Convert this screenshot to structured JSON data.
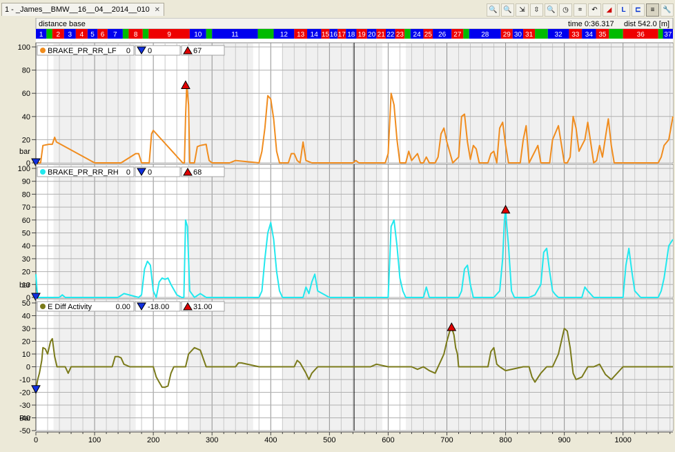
{
  "window": {
    "tab_title": "1 - _James__BMW__16__04__2014__010"
  },
  "toolbar": {
    "icons": [
      "zoom-2d-icon",
      "zoom-in-icon",
      "zoom-x-icon",
      "zoom-y-icon",
      "zoom-out-icon",
      "clock-icon",
      "overlay-icon",
      "undo-icon",
      "triangle-marker-icon",
      "axis-l-icon",
      "axis-steps-icon",
      "grid-lines-icon",
      "wrench-icon"
    ]
  },
  "header": {
    "base_label": "distance base",
    "time_label": "time 0:36.317",
    "dist_label": "dist 542.0 [m]"
  },
  "colors": {
    "segment_blue": "#0000ee",
    "segment_red": "#ee0000",
    "segment_green": "#00bb00",
    "plot_bg": "#ffffff",
    "shade_bg": "#f0f0f0"
  },
  "segments": [
    {
      "label": "1",
      "color": "blue",
      "start": 0,
      "end": 18
    },
    {
      "label": "",
      "color": "green",
      "start": 18,
      "end": 28
    },
    {
      "label": "2",
      "color": "red",
      "start": 28,
      "end": 48
    },
    {
      "label": "3",
      "color": "blue",
      "start": 48,
      "end": 68
    },
    {
      "label": "4",
      "color": "red",
      "start": 68,
      "end": 88
    },
    {
      "label": "5",
      "color": "blue",
      "start": 88,
      "end": 105
    },
    {
      "label": "6",
      "color": "red",
      "start": 105,
      "end": 122
    },
    {
      "label": "7",
      "color": "blue",
      "start": 122,
      "end": 148
    },
    {
      "label": "",
      "color": "green",
      "start": 148,
      "end": 158
    },
    {
      "label": "8",
      "color": "red",
      "start": 158,
      "end": 182
    },
    {
      "label": "",
      "color": "green",
      "start": 182,
      "end": 192
    },
    {
      "label": "9",
      "color": "red",
      "start": 192,
      "end": 262
    },
    {
      "label": "10",
      "color": "blue",
      "start": 262,
      "end": 290
    },
    {
      "label": "",
      "color": "green",
      "start": 290,
      "end": 300
    },
    {
      "label": "11",
      "color": "blue",
      "start": 300,
      "end": 378
    },
    {
      "label": "",
      "color": "green",
      "start": 378,
      "end": 405
    },
    {
      "label": "12",
      "color": "blue",
      "start": 405,
      "end": 440
    },
    {
      "label": "13",
      "color": "red",
      "start": 440,
      "end": 462
    },
    {
      "label": "14",
      "color": "blue",
      "start": 462,
      "end": 486
    },
    {
      "label": "15",
      "color": "red",
      "start": 486,
      "end": 500
    },
    {
      "label": "16",
      "color": "blue",
      "start": 500,
      "end": 514
    },
    {
      "label": "17",
      "color": "red",
      "start": 514,
      "end": 528
    },
    {
      "label": "18",
      "color": "blue",
      "start": 528,
      "end": 546
    },
    {
      "label": "19",
      "color": "red",
      "start": 546,
      "end": 564
    },
    {
      "label": "20",
      "color": "blue",
      "start": 564,
      "end": 580
    },
    {
      "label": "21",
      "color": "red",
      "start": 580,
      "end": 596
    },
    {
      "label": "22",
      "color": "blue",
      "start": 596,
      "end": 612
    },
    {
      "label": "23",
      "color": "red",
      "start": 612,
      "end": 628
    },
    {
      "label": "",
      "color": "green",
      "start": 628,
      "end": 638
    },
    {
      "label": "24",
      "color": "blue",
      "start": 638,
      "end": 660
    },
    {
      "label": "25",
      "color": "red",
      "start": 660,
      "end": 676
    },
    {
      "label": "26",
      "color": "blue",
      "start": 676,
      "end": 708
    },
    {
      "label": "27",
      "color": "red",
      "start": 708,
      "end": 728
    },
    {
      "label": "",
      "color": "green",
      "start": 728,
      "end": 738
    },
    {
      "label": "28",
      "color": "blue",
      "start": 738,
      "end": 792
    },
    {
      "label": "29",
      "color": "red",
      "start": 792,
      "end": 812
    },
    {
      "label": "30",
      "color": "blue",
      "start": 812,
      "end": 830
    },
    {
      "label": "31",
      "color": "red",
      "start": 830,
      "end": 850
    },
    {
      "label": "",
      "color": "green",
      "start": 850,
      "end": 872
    },
    {
      "label": "32",
      "color": "blue",
      "start": 872,
      "end": 908
    },
    {
      "label": "33",
      "color": "red",
      "start": 908,
      "end": 930
    },
    {
      "label": "34",
      "color": "blue",
      "start": 930,
      "end": 954
    },
    {
      "label": "35",
      "color": "red",
      "start": 954,
      "end": 976
    },
    {
      "label": "",
      "color": "green",
      "start": 976,
      "end": 1000
    },
    {
      "label": "36",
      "color": "red",
      "start": 1000,
      "end": 1060
    },
    {
      "label": "",
      "color": "green",
      "start": 1060,
      "end": 1068
    },
    {
      "label": "37",
      "color": "blue",
      "start": 1068,
      "end": 1085
    }
  ],
  "chart_data": {
    "type": "line",
    "x_axis": {
      "label": "",
      "range": [
        0,
        1085
      ],
      "ticks": [
        0,
        100,
        200,
        300,
        400,
        500,
        600,
        700,
        800,
        900,
        1000
      ]
    },
    "cursor_x": 542.0,
    "panels": [
      {
        "name": "BRAKE_PR_RR_LF",
        "value_text": "0",
        "min_text": "0",
        "max_text": "67",
        "unit": "bar",
        "color": "#f08c1e",
        "ylim": [
          0,
          100
        ],
        "yticks": [
          0,
          20,
          40,
          60,
          80,
          100
        ],
        "min_marker": {
          "x": 0,
          "y": 0
        },
        "max_marker": {
          "x": 255,
          "y": 67
        },
        "x": [
          0,
          8,
          12,
          22,
          28,
          32,
          35,
          100,
          130,
          135,
          145,
          170,
          175,
          180,
          185,
          190,
          193,
          197,
          200,
          250,
          253,
          255,
          257,
          260,
          262,
          270,
          275,
          280,
          290,
          292,
          295,
          300,
          330,
          340,
          380,
          385,
          390,
          395,
          400,
          405,
          410,
          415,
          430,
          435,
          440,
          445,
          450,
          455,
          460,
          470,
          475,
          480,
          485,
          500,
          540,
          545,
          550,
          595,
          600,
          605,
          610,
          615,
          620,
          630,
          635,
          640,
          650,
          655,
          660,
          665,
          670,
          675,
          680,
          685,
          690,
          695,
          700,
          710,
          720,
          725,
          730,
          735,
          740,
          745,
          750,
          755,
          760,
          770,
          775,
          780,
          785,
          790,
          795,
          800,
          805,
          810,
          815,
          820,
          825,
          830,
          835,
          840,
          850,
          855,
          860,
          870,
          875,
          880,
          890,
          900,
          905,
          910,
          915,
          920,
          925,
          930,
          935,
          940,
          950,
          955,
          960,
          965,
          970,
          975,
          980,
          985,
          990,
          1000,
          1010,
          1020,
          1030,
          1040,
          1050,
          1060,
          1065,
          1070,
          1078,
          1085
        ],
        "y": [
          0,
          0,
          15,
          16,
          16,
          22,
          18,
          0,
          0,
          0,
          0,
          8,
          8,
          0,
          0,
          0,
          0,
          25,
          28,
          0,
          0,
          40,
          67,
          50,
          0,
          0,
          14,
          15,
          16,
          10,
          2,
          0,
          0,
          2,
          0,
          10,
          30,
          58,
          55,
          38,
          10,
          0,
          0,
          8,
          8,
          2,
          0,
          18,
          2,
          0,
          0,
          0,
          0,
          0,
          0,
          2,
          0,
          0,
          8,
          60,
          50,
          20,
          0,
          0,
          10,
          2,
          8,
          0,
          0,
          5,
          0,
          0,
          0,
          5,
          25,
          30,
          18,
          0,
          5,
          40,
          42,
          18,
          3,
          15,
          12,
          0,
          0,
          0,
          8,
          10,
          0,
          30,
          35,
          15,
          0,
          0,
          0,
          0,
          0,
          20,
          32,
          0,
          10,
          15,
          0,
          0,
          0,
          20,
          32,
          0,
          0,
          5,
          40,
          30,
          10,
          15,
          20,
          35,
          0,
          2,
          15,
          5,
          22,
          38,
          15,
          0,
          0,
          0,
          0,
          0,
          0,
          0,
          0,
          0,
          5,
          15,
          20,
          40
        ]
      },
      {
        "name": "BRAKE_PR_RR_RH",
        "value_text": "0",
        "min_text": "0",
        "max_text": "68",
        "unit": "bar",
        "color": "#22e8ee",
        "ylim": [
          0,
          100
        ],
        "yticks": [
          0,
          10,
          20,
          30,
          40,
          50,
          60,
          70,
          80,
          90,
          100
        ],
        "min_marker": {
          "x": 0,
          "y": 0
        },
        "max_marker": {
          "x": 800,
          "y": 68
        },
        "x": [
          0,
          2,
          4,
          10,
          40,
          45,
          50,
          60,
          140,
          150,
          175,
          180,
          185,
          190,
          195,
          200,
          205,
          210,
          215,
          220,
          225,
          230,
          240,
          248,
          252,
          255,
          258,
          262,
          270,
          280,
          290,
          300,
          380,
          385,
          390,
          395,
          400,
          405,
          410,
          415,
          420,
          430,
          455,
          460,
          465,
          470,
          475,
          480,
          500,
          540,
          560,
          570,
          600,
          605,
          610,
          615,
          620,
          625,
          630,
          640,
          660,
          665,
          670,
          680,
          700,
          720,
          725,
          730,
          735,
          740,
          745,
          760,
          780,
          790,
          795,
          798,
          800,
          802,
          805,
          810,
          815,
          820,
          830,
          840,
          850,
          860,
          865,
          870,
          875,
          880,
          885,
          890,
          900,
          920,
          930,
          935,
          940,
          950,
          990,
          1000,
          1005,
          1010,
          1015,
          1020,
          1030,
          1050,
          1060,
          1065,
          1070,
          1078,
          1085
        ],
        "y": [
          18,
          5,
          0,
          0,
          0,
          2,
          0,
          0,
          0,
          3,
          0,
          2,
          22,
          28,
          25,
          5,
          0,
          12,
          15,
          14,
          15,
          10,
          2,
          0,
          0,
          60,
          55,
          5,
          0,
          3,
          0,
          0,
          0,
          5,
          30,
          50,
          58,
          45,
          20,
          5,
          0,
          0,
          0,
          8,
          3,
          12,
          18,
          5,
          0,
          0,
          0,
          0,
          0,
          55,
          60,
          40,
          15,
          5,
          0,
          0,
          0,
          8,
          0,
          0,
          0,
          0,
          5,
          22,
          25,
          10,
          0,
          0,
          0,
          5,
          30,
          60,
          68,
          55,
          40,
          5,
          0,
          0,
          0,
          0,
          2,
          10,
          35,
          38,
          20,
          5,
          2,
          0,
          0,
          0,
          0,
          8,
          5,
          0,
          0,
          0,
          25,
          38,
          20,
          5,
          0,
          0,
          0,
          5,
          15,
          40,
          45
        ]
      },
      {
        "name": "E Diff Activity",
        "value_text": "0.00",
        "min_text": "-18.00",
        "max_text": "31.00",
        "unit": "Bar",
        "color": "#7a7a1a",
        "ylim": [
          -50,
          50
        ],
        "yticks": [
          -50,
          -40,
          -30,
          -20,
          -10,
          0,
          10,
          20,
          30,
          40,
          50
        ],
        "min_marker": {
          "x": 0,
          "y": -18
        },
        "max_marker": {
          "x": 708,
          "y": 31
        },
        "x": [
          0,
          3,
          6,
          10,
          12,
          16,
          20,
          25,
          28,
          32,
          36,
          40,
          50,
          55,
          60,
          100,
          130,
          135,
          140,
          145,
          150,
          160,
          175,
          180,
          200,
          205,
          210,
          215,
          220,
          225,
          230,
          235,
          240,
          255,
          260,
          270,
          280,
          290,
          295,
          300,
          340,
          345,
          350,
          380,
          395,
          400,
          440,
          445,
          450,
          460,
          465,
          470,
          480,
          500,
          540,
          560,
          570,
          580,
          600,
          620,
          640,
          650,
          660,
          670,
          680,
          690,
          695,
          700,
          705,
          708,
          712,
          715,
          718,
          720,
          740,
          760,
          770,
          775,
          780,
          785,
          790,
          800,
          830,
          840,
          845,
          850,
          860,
          870,
          875,
          880,
          890,
          900,
          905,
          910,
          915,
          920,
          930,
          940,
          950,
          960,
          970,
          980,
          990,
          1000,
          1010,
          1020,
          1030,
          1040,
          1050,
          1060,
          1085
        ],
        "y": [
          -18,
          -10,
          -5,
          5,
          15,
          14,
          10,
          20,
          22,
          8,
          0,
          0,
          0,
          -5,
          0,
          0,
          0,
          8,
          8,
          7,
          2,
          0,
          0,
          0,
          0,
          -8,
          -12,
          -16,
          -16,
          -15,
          -5,
          0,
          0,
          0,
          10,
          15,
          13,
          0,
          0,
          0,
          0,
          3,
          3,
          0,
          0,
          0,
          0,
          5,
          3,
          -5,
          -10,
          -5,
          0,
          0,
          0,
          0,
          0,
          2,
          0,
          0,
          0,
          -2,
          0,
          -3,
          -5,
          5,
          10,
          20,
          28,
          31,
          25,
          15,
          10,
          0,
          0,
          0,
          0,
          12,
          15,
          2,
          0,
          -3,
          0,
          0,
          -8,
          -12,
          -5,
          0,
          0,
          0,
          10,
          30,
          28,
          15,
          -5,
          -10,
          -8,
          0,
          0,
          2,
          -6,
          -10,
          -5,
          0,
          0,
          0,
          0,
          0,
          0,
          0,
          0,
          0,
          0
        ]
      }
    ]
  }
}
